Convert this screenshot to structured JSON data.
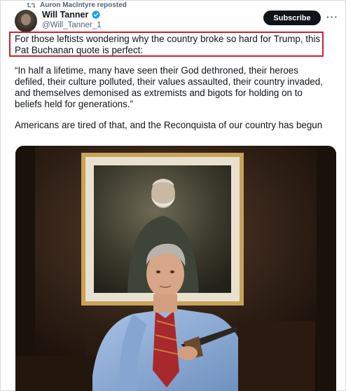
{
  "repost": {
    "icon": "repost-icon",
    "text": "Auron MacIntyre reposted"
  },
  "author": {
    "name": "Will Tanner",
    "handle": "@Will_Tanner_1",
    "verified_icon": "verified-badge-icon",
    "verified_color": "#1d9bf0"
  },
  "actions": {
    "subscribe_label": "Subscribe",
    "more_icon": "more-options-icon"
  },
  "tweet": {
    "paragraph_1": "For those leftists wondering why the country broke so hard for Trump, this Pat Buchanan quote is perfect:",
    "paragraph_2": "“In half a lifetime, many have seen their God dethroned, their heroes defiled, their culture polluted, their values assaulted, their country invaded, and themselves demonised as extremists and bigots for holding on to beliefs held for generations.”",
    "paragraph_3": "Americans are tired of that, and the Reconquista of our country has begun"
  },
  "colors": {
    "highlight_border": "#c8222f",
    "secondary_text": "#536471",
    "primary_text": "#0f1419"
  }
}
